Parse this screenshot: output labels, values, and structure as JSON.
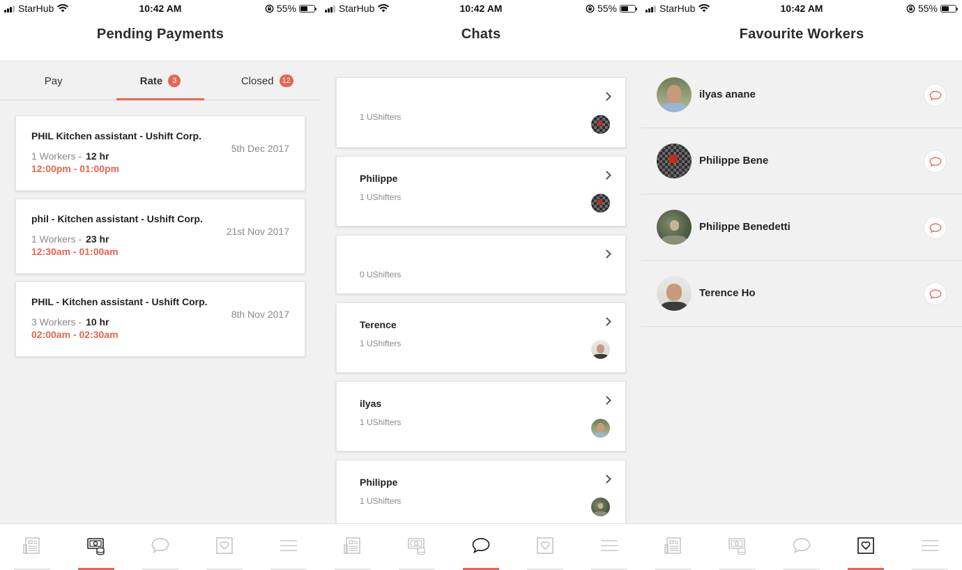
{
  "status_bar": {
    "carrier": "StarHub",
    "time": "10:42 AM",
    "battery": "55%",
    "battery_level": 0.55
  },
  "accent_color": "#e8644d",
  "screens": {
    "payments": {
      "title": "Pending Payments",
      "tabs": [
        {
          "label": "Pay",
          "badge": ""
        },
        {
          "label": "Rate",
          "badge": "3"
        },
        {
          "label": "Closed",
          "badge": "12"
        }
      ],
      "active_tab": "Rate",
      "cards": [
        {
          "title": "PHIL Kitchen assistant - Ushift Corp.",
          "workers": "1 Workers -",
          "hours": "12 hr",
          "time": "12:00pm - 01:00pm",
          "date": "5th Dec 2017"
        },
        {
          "title": "phil - Kitchen assistant - Ushift Corp.",
          "workers": "1 Workers -",
          "hours": "23 hr",
          "time": "12:30am - 01:00am",
          "date": "21st Nov 2017"
        },
        {
          "title": "PHIL - Kitchen assistant - Ushift Corp.",
          "workers": "3 Workers -",
          "hours": "10 hr",
          "time": "02:00am - 02:30am",
          "date": "8th Nov 2017"
        }
      ]
    },
    "chats": {
      "title": "Chats",
      "items": [
        {
          "name": "",
          "count": "1 UShifters",
          "avatar": "checker-icon"
        },
        {
          "name": "Philippe",
          "count": "1 UShifters",
          "avatar": "checker-icon"
        },
        {
          "name": "",
          "count": "0 UShifters",
          "avatar": ""
        },
        {
          "name": "Terence",
          "count": "1 UShifters",
          "avatar": "terence-photo"
        },
        {
          "name": "ilyas",
          "count": "1 UShifters",
          "avatar": "ilyas-photo"
        },
        {
          "name": "Philippe",
          "count": "1 UShifters",
          "avatar": "philippe-benedetti-photo"
        }
      ]
    },
    "favourites": {
      "title": "Favourite Workers",
      "workers": [
        {
          "name": "ilyas anane",
          "avatar": "ilyas-photo"
        },
        {
          "name": "Philippe Bene",
          "avatar": "checker-icon"
        },
        {
          "name": "Philippe Benedetti",
          "avatar": "philippe-benedetti-photo"
        },
        {
          "name": "Terence Ho",
          "avatar": "terence-photo"
        }
      ]
    }
  },
  "bottom_nav": {
    "items": [
      "jobs-list-icon",
      "payments-icon",
      "chat-icon",
      "favourite-icon",
      "menu-icon"
    ],
    "active_per_screen": [
      "payments-icon",
      "chat-icon",
      "favourite-icon"
    ]
  }
}
